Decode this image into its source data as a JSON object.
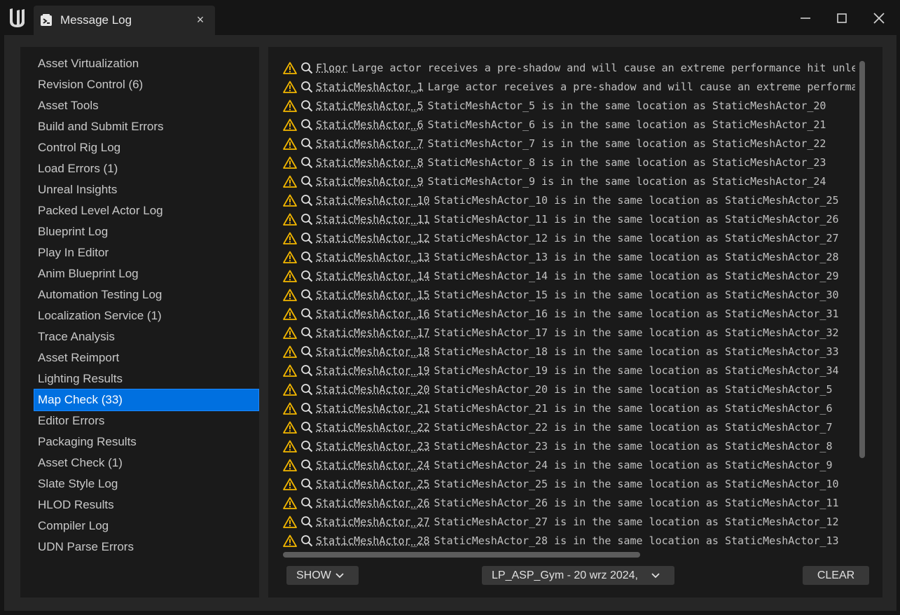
{
  "window": {
    "tab_title": "Message Log",
    "tab_close": "×",
    "logo_icon": "unreal-engine-logo",
    "tab_icon": "message-log-icon"
  },
  "sidebar": {
    "items": [
      {
        "label": "Asset Virtualization"
      },
      {
        "label": "Revision Control (6)"
      },
      {
        "label": "Asset Tools"
      },
      {
        "label": "Build and Submit Errors"
      },
      {
        "label": "Control Rig Log"
      },
      {
        "label": "Load Errors (1)"
      },
      {
        "label": "Unreal Insights"
      },
      {
        "label": "Packed Level Actor Log"
      },
      {
        "label": "Blueprint Log"
      },
      {
        "label": "Play In Editor"
      },
      {
        "label": "Anim Blueprint Log"
      },
      {
        "label": "Automation Testing Log"
      },
      {
        "label": "Localization Service (1)"
      },
      {
        "label": "Trace Analysis"
      },
      {
        "label": "Asset Reimport"
      },
      {
        "label": "Lighting Results"
      },
      {
        "label": "Map Check (33)",
        "active": true
      },
      {
        "label": "Editor Errors"
      },
      {
        "label": "Packaging Results"
      },
      {
        "label": "Asset Check (1)"
      },
      {
        "label": "Slate Style Log"
      },
      {
        "label": "HLOD Results"
      },
      {
        "label": "Compiler Log"
      },
      {
        "label": "UDN Parse Errors"
      }
    ]
  },
  "log": {
    "rows": [
      {
        "actor": "Floor",
        "message": "Large actor receives a pre-shadow and will cause an extreme performance hit unless bCastDynamicShadow is set to false."
      },
      {
        "actor": "StaticMeshActor_1",
        "message": "Large actor receives a pre-shadow and will cause an extreme performance hit unless bCastDynamicShadow is set to false."
      },
      {
        "actor": "StaticMeshActor_5",
        "message": "StaticMeshActor_5 is in the same location as StaticMeshActor_20"
      },
      {
        "actor": "StaticMeshActor_6",
        "message": "StaticMeshActor_6 is in the same location as StaticMeshActor_21"
      },
      {
        "actor": "StaticMeshActor_7",
        "message": "StaticMeshActor_7 is in the same location as StaticMeshActor_22"
      },
      {
        "actor": "StaticMeshActor_8",
        "message": "StaticMeshActor_8 is in the same location as StaticMeshActor_23"
      },
      {
        "actor": "StaticMeshActor_9",
        "message": "StaticMeshActor_9 is in the same location as StaticMeshActor_24"
      },
      {
        "actor": "StaticMeshActor_10",
        "message": "StaticMeshActor_10 is in the same location as StaticMeshActor_25"
      },
      {
        "actor": "StaticMeshActor_11",
        "message": "StaticMeshActor_11 is in the same location as StaticMeshActor_26"
      },
      {
        "actor": "StaticMeshActor_12",
        "message": "StaticMeshActor_12 is in the same location as StaticMeshActor_27"
      },
      {
        "actor": "StaticMeshActor_13",
        "message": "StaticMeshActor_13 is in the same location as StaticMeshActor_28"
      },
      {
        "actor": "StaticMeshActor_14",
        "message": "StaticMeshActor_14 is in the same location as StaticMeshActor_29"
      },
      {
        "actor": "StaticMeshActor_15",
        "message": "StaticMeshActor_15 is in the same location as StaticMeshActor_30"
      },
      {
        "actor": "StaticMeshActor_16",
        "message": "StaticMeshActor_16 is in the same location as StaticMeshActor_31"
      },
      {
        "actor": "StaticMeshActor_17",
        "message": "StaticMeshActor_17 is in the same location as StaticMeshActor_32"
      },
      {
        "actor": "StaticMeshActor_18",
        "message": "StaticMeshActor_18 is in the same location as StaticMeshActor_33"
      },
      {
        "actor": "StaticMeshActor_19",
        "message": "StaticMeshActor_19 is in the same location as StaticMeshActor_34"
      },
      {
        "actor": "StaticMeshActor_20",
        "message": "StaticMeshActor_20 is in the same location as StaticMeshActor_5"
      },
      {
        "actor": "StaticMeshActor_21",
        "message": "StaticMeshActor_21 is in the same location as StaticMeshActor_6"
      },
      {
        "actor": "StaticMeshActor_22",
        "message": "StaticMeshActor_22 is in the same location as StaticMeshActor_7"
      },
      {
        "actor": "StaticMeshActor_23",
        "message": "StaticMeshActor_23 is in the same location as StaticMeshActor_8"
      },
      {
        "actor": "StaticMeshActor_24",
        "message": "StaticMeshActor_24 is in the same location as StaticMeshActor_9"
      },
      {
        "actor": "StaticMeshActor_25",
        "message": "StaticMeshActor_25 is in the same location as StaticMeshActor_10"
      },
      {
        "actor": "StaticMeshActor_26",
        "message": "StaticMeshActor_26 is in the same location as StaticMeshActor_11"
      },
      {
        "actor": "StaticMeshActor_27",
        "message": "StaticMeshActor_27 is in the same location as StaticMeshActor_12"
      },
      {
        "actor": "StaticMeshActor_28",
        "message": "StaticMeshActor_28 is in the same location as StaticMeshActor_13"
      }
    ],
    "row_icons": [
      "warning-icon",
      "find-in-level-icon"
    ]
  },
  "footer": {
    "show_label": "SHOW",
    "session_label": "LP_ASP_Gym - 20 wrz 2024,",
    "clear_label": "CLEAR"
  },
  "colors": {
    "accent": "#0070e0",
    "warning": "#f2b600",
    "panel": "#1a1a1a",
    "frame": "#262626"
  }
}
